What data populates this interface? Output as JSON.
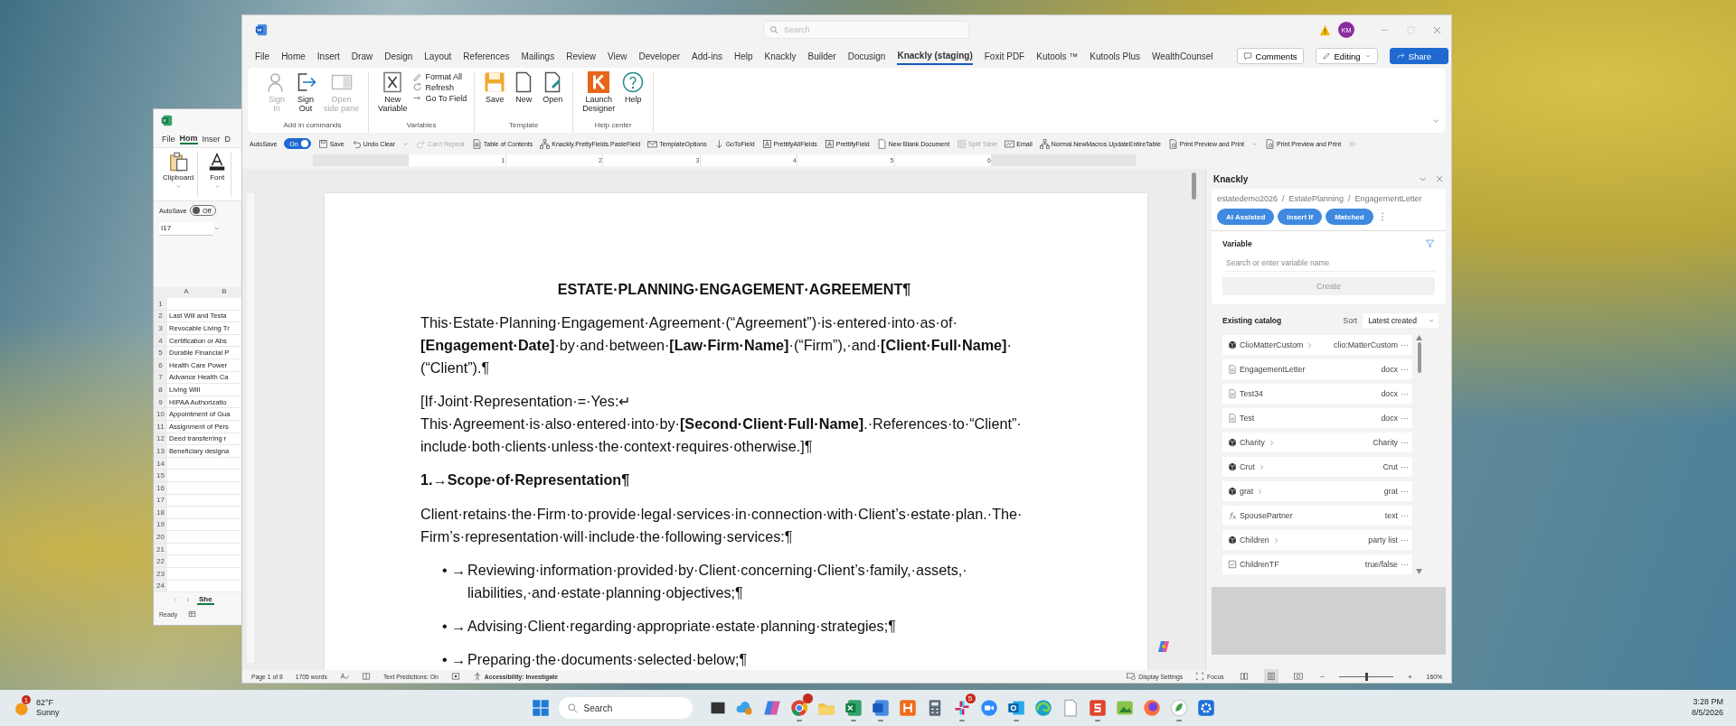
{
  "excel_window": {
    "tabs": [
      {
        "label": "File",
        "selected": false
      },
      {
        "label": "Hom",
        "selected": true
      },
      {
        "label": "Inser",
        "selected": false
      },
      {
        "label": "D",
        "selected": false
      }
    ],
    "ribbon_groups": [
      {
        "label": "Clipboard"
      },
      {
        "label": "Font"
      }
    ],
    "autosave": {
      "label": "AutoSave",
      "on": false,
      "state_text": "Off"
    },
    "name_box": "I17",
    "columns": [
      "A",
      "B"
    ],
    "rows": [
      {
        "number": "1"
      },
      {
        "number": "2",
        "cell_a": "Last Will and Testa"
      },
      {
        "number": "3",
        "cell_a": "Revocable Living Tr"
      },
      {
        "number": "4",
        "cell_a": "Certification or Abs"
      },
      {
        "number": "5",
        "cell_a": "Durable Financial P"
      },
      {
        "number": "6",
        "cell_a": "Health Care Power"
      },
      {
        "number": "7",
        "cell_a": "Advance Health Ca"
      },
      {
        "number": "8",
        "cell_a": "Living Will"
      },
      {
        "number": "9",
        "cell_a": "HIPAA Authorizatio"
      },
      {
        "number": "10",
        "cell_a": "Appointment of Gua"
      },
      {
        "number": "11",
        "cell_a": "Assignment of Pers"
      },
      {
        "number": "12",
        "cell_a": "Deed transferring r"
      },
      {
        "number": "13",
        "cell_a": "Beneficiary designa"
      },
      {
        "number": "14"
      },
      {
        "number": "15"
      },
      {
        "number": "16"
      },
      {
        "number": "17"
      },
      {
        "number": "18"
      },
      {
        "number": "19"
      },
      {
        "number": "20"
      },
      {
        "number": "21"
      },
      {
        "number": "22"
      },
      {
        "number": "23"
      },
      {
        "number": "24"
      }
    ],
    "sheet_tab": "She",
    "status": "Ready"
  },
  "word_window": {
    "search": {
      "placeholder": "Search"
    },
    "account": {
      "initials": "KM"
    },
    "menu_tabs": [
      {
        "label": "File",
        "selected": false
      },
      {
        "label": "Home",
        "selected": false
      },
      {
        "label": "Insert",
        "selected": false
      },
      {
        "label": "Draw",
        "selected": false
      },
      {
        "label": "Design",
        "selected": false
      },
      {
        "label": "Layout",
        "selected": false
      },
      {
        "label": "References",
        "selected": false
      },
      {
        "label": "Mailings",
        "selected": false
      },
      {
        "label": "Review",
        "selected": false
      },
      {
        "label": "View",
        "selected": false
      },
      {
        "label": "Developer",
        "selected": false
      },
      {
        "label": "Add-ins",
        "selected": false
      },
      {
        "label": "Help",
        "selected": false
      },
      {
        "label": "Knackly",
        "selected": false
      },
      {
        "label": "Builder",
        "selected": false
      },
      {
        "label": "Docusign",
        "selected": false
      },
      {
        "label": "Knackly (staging)",
        "selected": true
      },
      {
        "label": "Foxit PDF",
        "selected": false
      },
      {
        "label": "Kutools ™",
        "selected": false
      },
      {
        "label": "Kutools Plus",
        "selected": false
      },
      {
        "label": "WealthCounsel",
        "selected": false
      }
    ],
    "actions": {
      "comments": "Comments",
      "editing": "Editing",
      "share": "Share"
    },
    "ribbon_groups": [
      {
        "label": "Add in commands",
        "buttons": [
          {
            "kind": "large",
            "label": "Sign\nIn",
            "disabled": true
          },
          {
            "kind": "large",
            "label": "Sign\nOut",
            "disabled": false
          },
          {
            "kind": "large",
            "label": "Open\nside pane",
            "disabled": true
          }
        ]
      },
      {
        "label": "Variables",
        "buttons": [
          {
            "kind": "large",
            "label": "New\nVariable",
            "disabled": false
          },
          {
            "kind": "small",
            "label": "Format All",
            "disabled": false
          },
          {
            "kind": "small",
            "label": "Refresh",
            "disabled": false
          },
          {
            "kind": "small",
            "label": "Go To Field",
            "disabled": false
          }
        ]
      },
      {
        "label": "Template",
        "buttons": [
          {
            "kind": "large",
            "label": "Save",
            "disabled": false
          },
          {
            "kind": "large",
            "label": "New",
            "disabled": false
          },
          {
            "kind": "large",
            "label": "Open",
            "disabled": false
          }
        ]
      },
      {
        "label": "Help center",
        "buttons": [
          {
            "kind": "large",
            "label": "Launch\nDesigner",
            "disabled": false
          },
          {
            "kind": "large",
            "label": "Help",
            "disabled": false
          }
        ]
      }
    ],
    "quick_access": {
      "autosave_label": "AutoSave",
      "autosave": {
        "on": true,
        "state_text": "On"
      },
      "items": [
        {
          "label": "Save",
          "disabled": false,
          "dropdown": false
        },
        {
          "label": "Undo Clear",
          "disabled": false,
          "dropdown": true
        },
        {
          "label": "Can't Repeat",
          "disabled": true,
          "dropdown": false
        },
        {
          "label": "Table of Contents",
          "disabled": false,
          "dropdown": false
        },
        {
          "label": "Knackly.PrettyFields.PasteField",
          "disabled": false,
          "dropdown": false
        },
        {
          "label": "TemplateOptions",
          "disabled": false,
          "dropdown": false
        },
        {
          "label": "GoToField",
          "disabled": false,
          "dropdown": false
        },
        {
          "label": "PrettifyAllFields",
          "disabled": false,
          "dropdown": false
        },
        {
          "label": "PrettifyField",
          "disabled": false,
          "dropdown": false
        },
        {
          "label": "New Blank Document",
          "disabled": false,
          "dropdown": false
        },
        {
          "label": "Split Table",
          "disabled": true,
          "dropdown": false
        },
        {
          "label": "Email",
          "disabled": false,
          "dropdown": false
        },
        {
          "label": "Normal.NewMacros.UpdateEntireTable",
          "disabled": false,
          "dropdown": false
        },
        {
          "label": "Print Preview and Print",
          "disabled": false,
          "dropdown": true
        },
        {
          "label": "Print Preview and Print",
          "disabled": false,
          "dropdown": false
        }
      ]
    },
    "ruler": [
      "1",
      "2",
      "3",
      "4",
      "5",
      "6"
    ],
    "document": {
      "title": "ESTATE·PLANNING·ENGAGEMENT·AGREEMENT¶",
      "blocks": [
        {
          "kind": "paragraph",
          "lines": [
            "This·Estate·Planning·Engagement·Agreement·(“Agreement”)·is·entered·into·as·of·",
            "**[Engagement·Date]**·by·and·between·**[Law·Firm·Name]**·(“Firm”),·and·**[Client·Full·Name]**·",
            "(“Client”).¶"
          ]
        },
        {
          "kind": "paragraph",
          "lines": [
            "[If·Joint·Representation·=·Yes:↵",
            "This·Agreement·is·also·entered·into·by·**[Second·Client·Full·Name]**.·References·to·“Client”·",
            "include·both·clients·unless·the·context·requires·otherwise.]¶"
          ]
        },
        {
          "kind": "heading",
          "number": "1.→",
          "lines": [
            "Scope·of·Representation¶"
          ]
        },
        {
          "kind": "paragraph",
          "lines": [
            "Client·retains·the·Firm·to·provide·legal·services·in·connection·with·Client’s·estate·plan.·The·",
            "Firm’s·representation·will·include·the·following·services:¶"
          ]
        },
        {
          "kind": "bullet",
          "marker": "•",
          "tab": "→",
          "lines": [
            "Reviewing·information·provided·by·Client·concerning·Client’s·family,·assets,·",
            "liabilities,·and·estate·planning·objectives;¶"
          ]
        },
        {
          "kind": "bullet",
          "marker": "•",
          "tab": "→",
          "lines": [
            "Advising·Client·regarding·appropriate·estate·planning·strategies;¶"
          ]
        },
        {
          "kind": "bullet",
          "marker": "•",
          "tab": "→",
          "lines": [
            "Preparing·the·documents·selected·below;¶"
          ]
        }
      ]
    },
    "knackly_pane": {
      "title": "Knackly",
      "breadcrumb": "estatedemo2026  /  EstatePlanning  /  EngagementLetter",
      "toolbar": [
        {
          "label": "AI Assisted"
        },
        {
          "label": "Insert If"
        },
        {
          "label": "Matched"
        }
      ],
      "variable": {
        "label": "Variable",
        "placeholder": "Search or enter variable name",
        "create": {
          "label": "Create",
          "disabled": true
        }
      },
      "catalog": {
        "label": "Existing catalog",
        "sort_label": "Sort",
        "sort_value": "Latest created",
        "items": [
          {
            "kind": "object",
            "name": "ClioMatterCustom",
            "expandable": true,
            "type": "clio:MatterCustom"
          },
          {
            "kind": "document",
            "name": "EngagementLetter",
            "expandable": false,
            "type": "docx"
          },
          {
            "kind": "document",
            "name": "Test34",
            "expandable": false,
            "type": "docx"
          },
          {
            "kind": "document",
            "name": "Test",
            "expandable": false,
            "type": "docx"
          },
          {
            "kind": "object",
            "name": "Charity",
            "expandable": true,
            "type": "Charity"
          },
          {
            "kind": "object",
            "name": "Crut",
            "expandable": true,
            "type": "Crut"
          },
          {
            "kind": "object",
            "name": "grat",
            "expandable": true,
            "type": "grat"
          },
          {
            "kind": "formula",
            "name": "SpousePartner",
            "expandable": false,
            "type": "text"
          },
          {
            "kind": "object",
            "name": "Children",
            "expandable": true,
            "type": "party list"
          },
          {
            "kind": "checkbox",
            "name": "ChildrenTF",
            "expandable": false,
            "type": "true/false"
          }
        ]
      }
    },
    "status_bar": {
      "page": "Page 1 of 8",
      "words": "1705 words",
      "text_predictions": "Text Predictions: On",
      "accessibility": "Accessibility: Investigate",
      "display_settings": "Display Settings",
      "focus": "Focus",
      "views": [
        {
          "selected": false
        },
        {
          "selected": true
        },
        {
          "selected": false
        }
      ],
      "zoom": {
        "level": 0.52,
        "reading": "160%"
      }
    }
  },
  "taskbar": {
    "weather": {
      "temperature": "82°F",
      "condition": "Sunny",
      "badge": "1"
    },
    "search": {
      "placeholder": "Search"
    },
    "apps": [
      {
        "running": false,
        "alert": false
      },
      {
        "running": false,
        "alert": false
      },
      {
        "running": false,
        "alert": false
      },
      {
        "running": true,
        "alert": true
      },
      {
        "running": false,
        "alert": false
      },
      {
        "running": true,
        "alert": false
      },
      {
        "running": true,
        "alert": false
      },
      {
        "running": false,
        "alert": false
      },
      {
        "running": false,
        "alert": false
      },
      {
        "running": true,
        "alert": true,
        "badge": "5"
      },
      {
        "running": false,
        "alert": false
      },
      {
        "running": true,
        "alert": false
      },
      {
        "running": false,
        "alert": false
      },
      {
        "running": false,
        "alert": false
      },
      {
        "running": true,
        "alert": false
      },
      {
        "running": false,
        "alert": false
      },
      {
        "running": false,
        "alert": false
      },
      {
        "running": true,
        "alert": false
      },
      {
        "running": false,
        "alert": false
      }
    ],
    "clock": {
      "time": "3:28 PM",
      "date": "8/5/2026"
    }
  }
}
